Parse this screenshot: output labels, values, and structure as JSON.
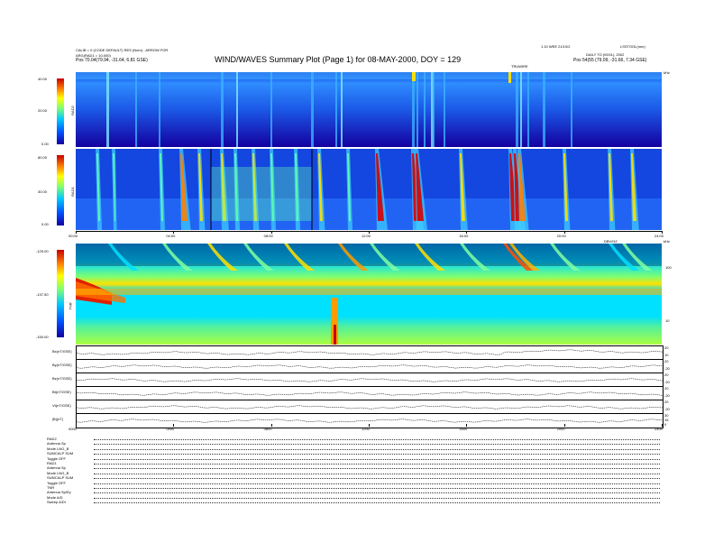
{
  "header": {
    "left_line1": "CALIB = 0 (CODE DEFAULT) RES (Nom) - ARROW FOR",
    "left_line2": "ARG(RAD1 = 10.000)",
    "left_line3": "Pos   70.04(79.94, -31.64, 6.81 GSE)",
    "title": "WIND/WAVES Summary Plot (Page 1) for 08-MAY-2000, DOY = 129",
    "right_top": "LSSTOOL(nnn)",
    "right_mid": "DAILY   TO (09/11), 2002",
    "right_line3": "Pos   54(55 (79.09, -31.66, 7.34 GSE)",
    "center_small": "1.10  WEE  21/10/2",
    "tick_label_top": "TRUWIRE"
  },
  "panels": {
    "rad2": {
      "label": "RAD2",
      "ticks": [
        "40.00",
        "20.00",
        "0.00"
      ]
    },
    "rad1": {
      "label": "RAD1",
      "ticks": [
        "80.00",
        "30.00",
        "0.00"
      ]
    },
    "tnr": {
      "label": "TNR",
      "ticks": [
        "-125.00",
        "-137.50",
        "-150.00"
      ],
      "right_ticks": [
        "100",
        "10"
      ],
      "right_unit": "kHz",
      "corner": "DBV/HZ"
    },
    "time_ticks_top": [
      "00:00",
      "04:00",
      "08:00",
      "12:00",
      "16:00",
      "20:00",
      "24:00"
    ],
    "time_ticks_bottom": [
      "0000",
      "0400",
      "0800",
      "1200",
      "1600",
      "2000",
      "2400"
    ],
    "unit_right_rad": "kHz"
  },
  "mag": {
    "rows": [
      {
        "label": "Bx(nT/GSE)",
        "right": [
          "20",
          "10"
        ]
      },
      {
        "label": "By(nT/GSE)",
        "right": [
          "20",
          "-20"
        ]
      },
      {
        "label": "Bz(nT/GSE)",
        "right": [
          "20",
          "-20"
        ]
      },
      {
        "label": "Bt(nT/GSE)",
        "right": [
          "20",
          "-20"
        ]
      },
      {
        "label": "Vt(nT/GSE)",
        "right": [
          "20",
          "-20"
        ]
      },
      {
        "label": "|B|(nT)",
        "right": [
          "30",
          "15",
          "0"
        ]
      }
    ]
  },
  "footer": {
    "rows": [
      "RAD2",
      "Antenna   Sp",
      "Mode    LNG_B",
      "SUMCALP  SUM",
      "Toggle    OFF",
      "RAD1",
      "Antenna   Sp",
      "Mode   LNG_B",
      "SUMCALP  SUM",
      "Toggle    OFF",
      "TNR",
      "Antenna   Sp/Ey",
      "Mode     A/D",
      "Sweep    A/Dl"
    ]
  },
  "chart_data": {
    "type": "heatmap",
    "title": "WIND/WAVES Summary Plot (Page 1) for 08-MAY-2000, DOY = 129",
    "x": {
      "label": "",
      "range": [
        "00:00",
        "24:00"
      ]
    },
    "subplots": [
      {
        "name": "RAD2",
        "ylim": [
          0.0,
          40.0
        ]
      },
      {
        "name": "RAD1",
        "ylim": [
          0.0,
          80.0
        ]
      },
      {
        "name": "TNR",
        "ylim": [
          -150.0,
          -125.0
        ]
      }
    ],
    "colors": {
      "low": "#1a00a6",
      "mid_low": "#00c8ff",
      "mid": "#7fff70",
      "mid_high": "#ffff00",
      "high": "#c80000"
    }
  }
}
